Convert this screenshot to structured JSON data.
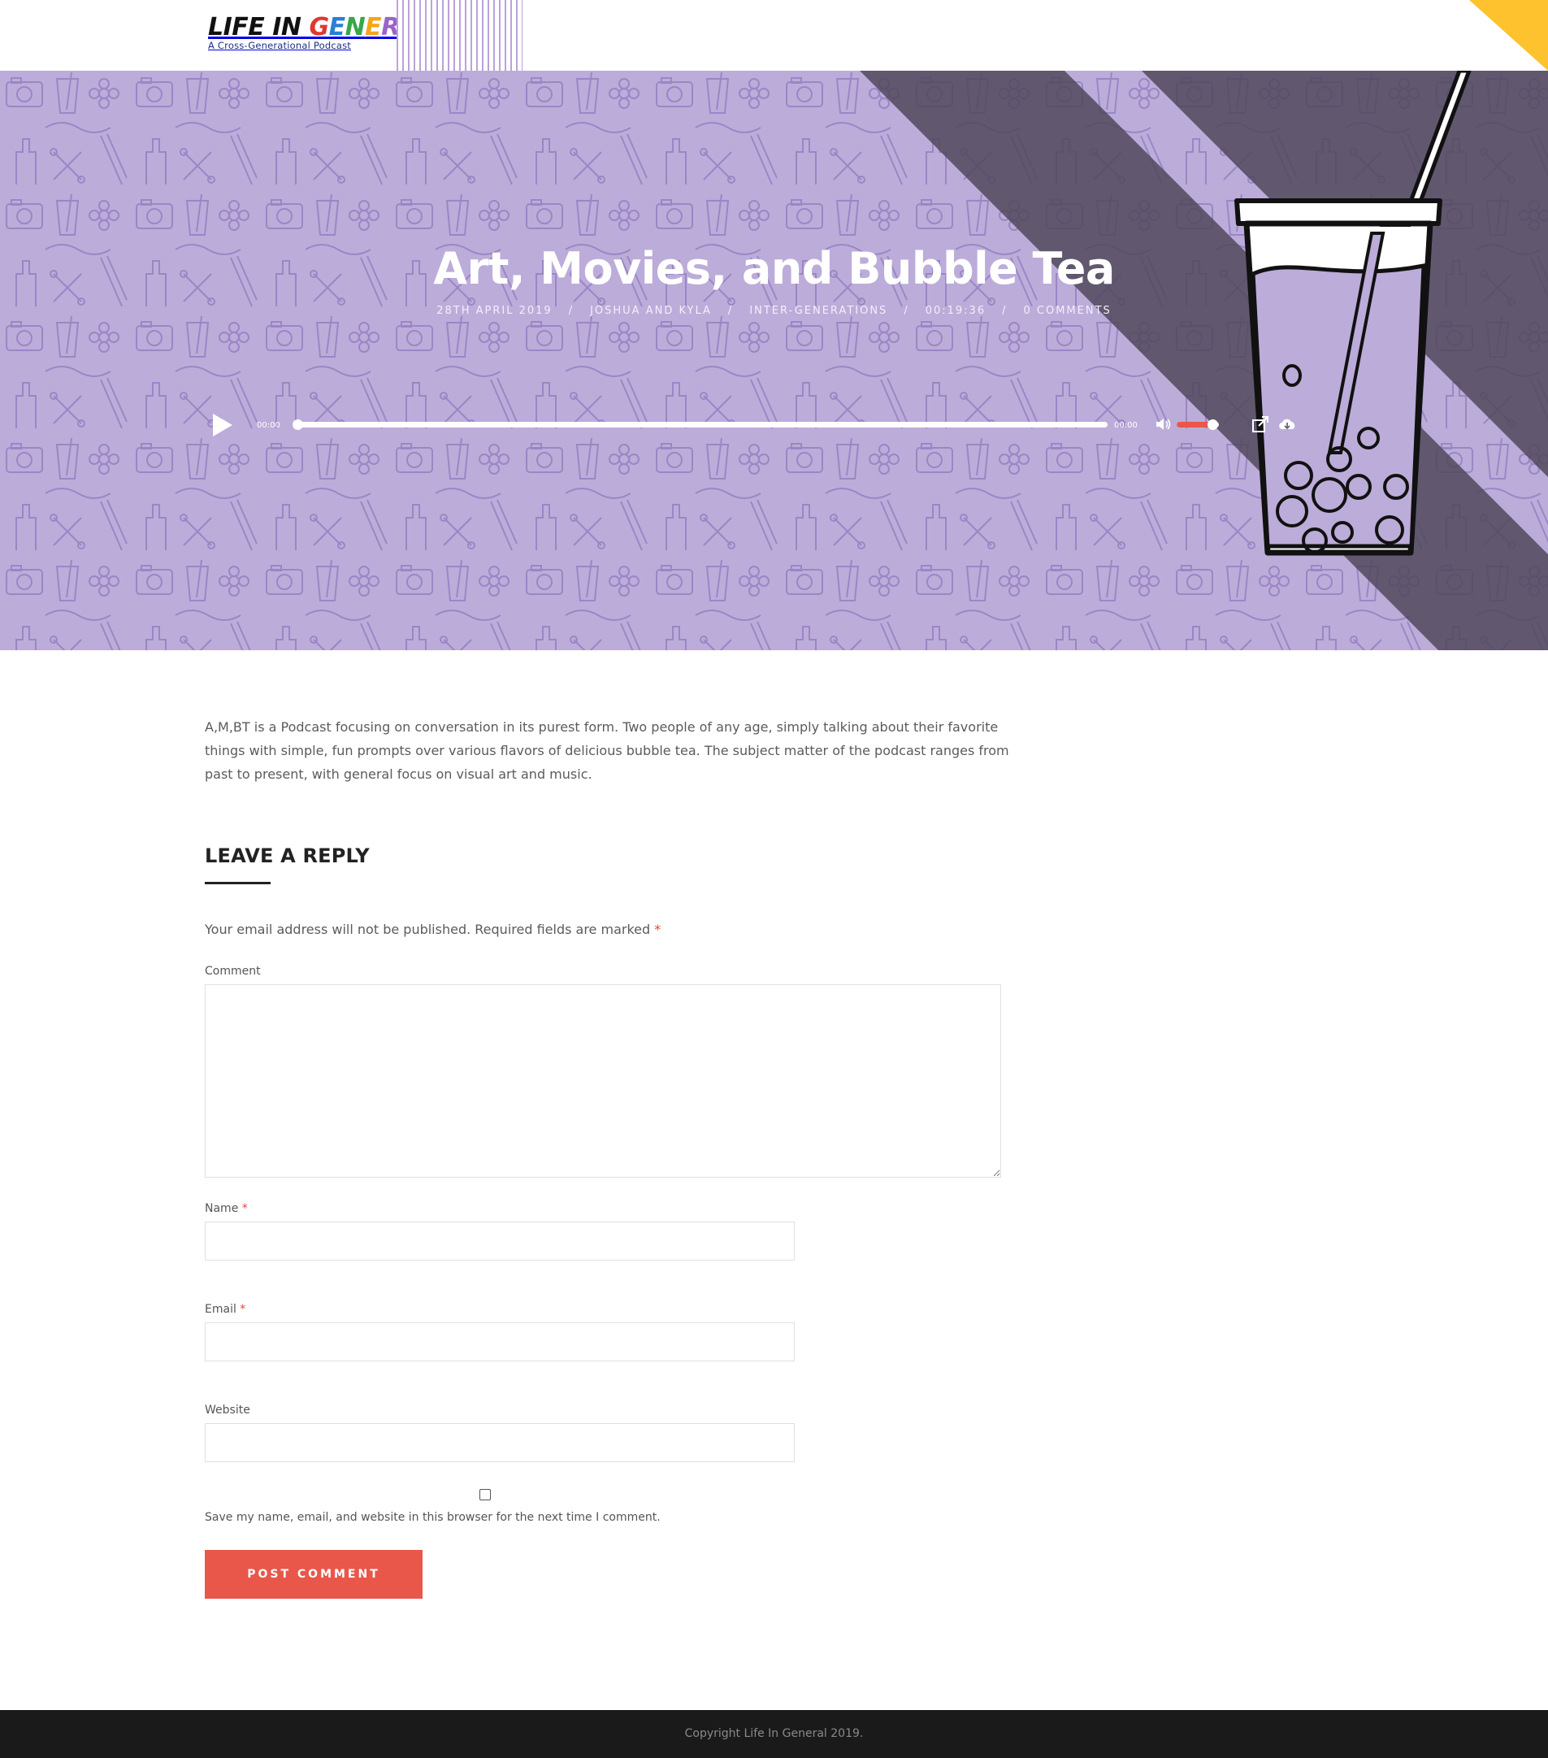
{
  "header": {
    "logo_title": "LIFE IN GENERAL",
    "logo_subtitle": "A Cross-Generational Podcast"
  },
  "hero": {
    "title": "Art, Movies, and Bubble Tea",
    "meta": {
      "date": "28TH APRIL 2019",
      "author": "JOSHUA AND KYLA",
      "category": "INTER-GENERATIONS",
      "duration": "00:19:36",
      "comments": "0 COMMENTS",
      "separator": "/"
    },
    "player": {
      "current_time": "00:00",
      "duration_time": "00:00",
      "progress": 0,
      "volume": 0.8,
      "accent_color": "#e8574a"
    },
    "background_color": "#bcacd9"
  },
  "post": {
    "excerpt": "A,M,BT is a Podcast focusing on conversation in its purest form. Two people of any age, simply talking about their favorite things with simple, fun prompts over various flavors of delicious bubble tea. The subject matter of the podcast ranges from past to present, with general focus on visual art and music."
  },
  "reply": {
    "title": "LEAVE A REPLY",
    "notes": "Your email address will not be published. Required fields are marked",
    "required_mark": "*",
    "comment_label": "Comment",
    "name_label": "Name",
    "email_label": "Email",
    "website_label": "Website",
    "cookies_text": "Save my name, email, and website in this browser for the next time I comment.",
    "submit_label": "POST COMMENT",
    "comment_value": "",
    "name_value": "",
    "email_value": "",
    "website_value": ""
  },
  "footer": {
    "copyright": "Copyright Life In General 2019."
  },
  "colors": {
    "accent": "#e8574a",
    "corner": "#fdc22e",
    "hero_purple": "#bcacd9",
    "hero_dark": "#6b6478",
    "footer_bg": "#1a1a1a"
  }
}
